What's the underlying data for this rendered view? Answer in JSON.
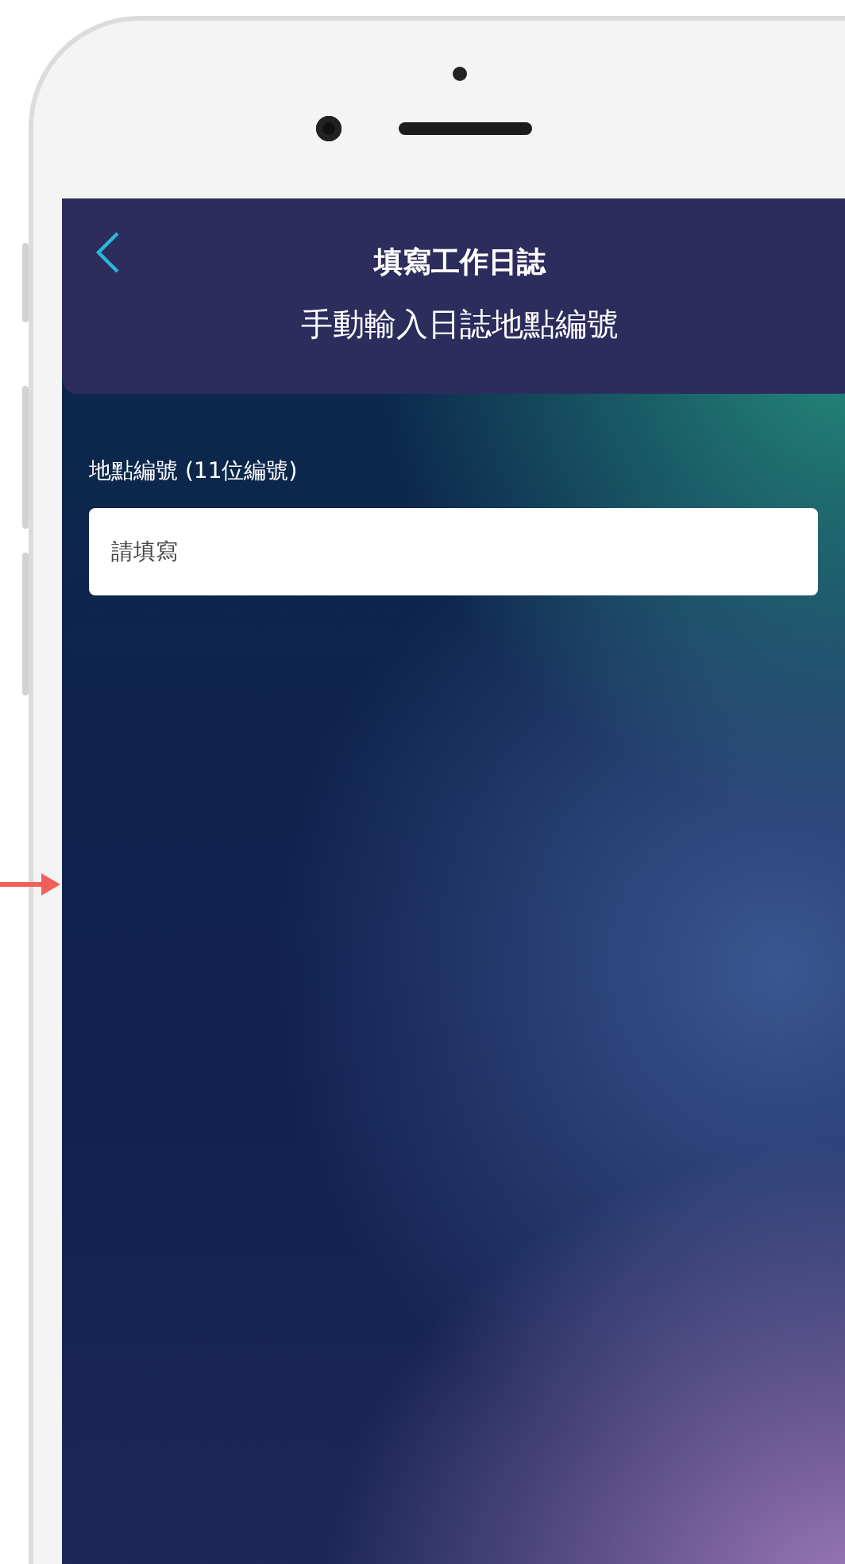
{
  "header": {
    "title": "填寫工作日誌",
    "subtitle": "手動輸入日誌地點編號"
  },
  "form": {
    "label": "地點編號 (11位編號)",
    "placeholder": "請填寫"
  }
}
